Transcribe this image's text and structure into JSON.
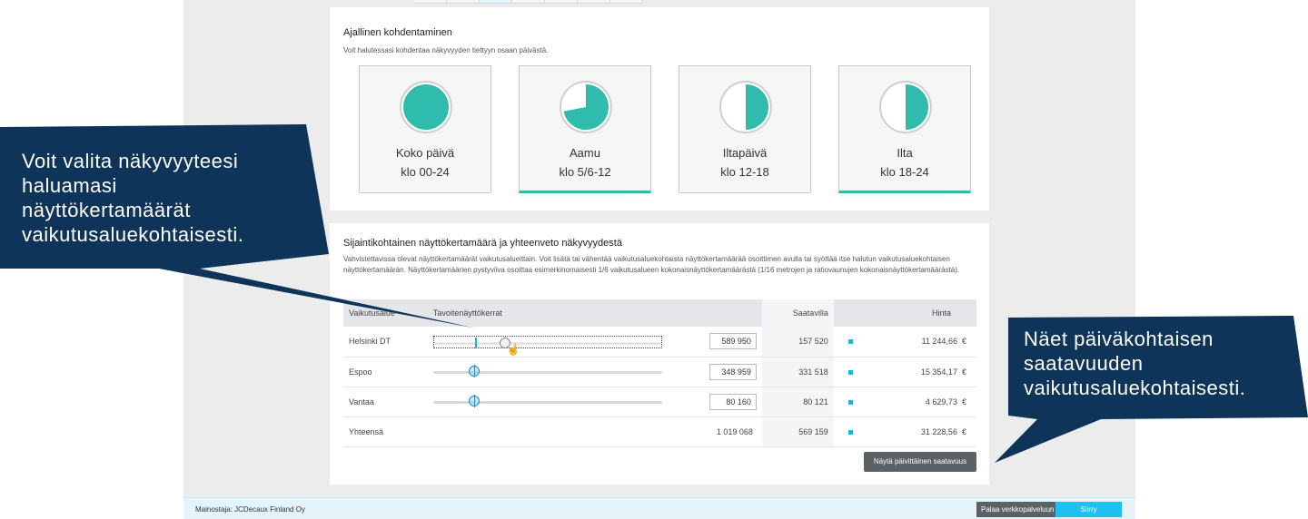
{
  "time_targeting": {
    "title": "Ajallinen kohdentaminen",
    "subtitle": "Voit halutessasi kohdentaa näkyvyyden tiettyyn osaan päivästä.",
    "options": [
      {
        "title": "Koko päivä",
        "time": "klo 00-24",
        "fill": 1.0,
        "selected": false
      },
      {
        "title": "Aamu",
        "time": "klo 5/6-12",
        "fill": 0.72,
        "selected": true
      },
      {
        "title": "Iltapäivä",
        "time": "klo 12-18",
        "fill": 0.5,
        "selected": false
      },
      {
        "title": "Ilta",
        "time": "klo 18-24",
        "fill": 0.5,
        "selected": true
      }
    ],
    "accent_color": "#2fbcac"
  },
  "location_summary": {
    "title": "Sijaintikohtainen näyttökertamäärä ja yhteenveto näkyvyydestä",
    "description": "Vahvistettavissa olevat näyttökertamäärät vaikutusalueittain. Voit lisätä tai vähentää vaikutusaluekohtaista näyttökertamäärää osoittimen avulla tai syöttää itse halutun vaikutusaluekohtaisen näyttökertamäärän. Näyttökertamäärien pystyviiva osoittaa esimerkinomaisesti 1/6 vaikutusalueen kokonaisnäyttökertamäärästä (1/16 metrojen ja ratiovaunujen kokonaisnäyttökertamäärästä).",
    "columns": {
      "area": "Vaikutusalue",
      "target": "Tavoitenäyttökerrat",
      "available": "Saatavilla",
      "price": "Hinta"
    },
    "rows": [
      {
        "area": "Helsinki DT",
        "target": "589 950",
        "available": "157 520",
        "price": "11 244,66",
        "currency": "€",
        "level": 0.31
      },
      {
        "area": "Espoo",
        "target": "348 959",
        "available": "331 518",
        "price": "15 354,17",
        "currency": "€",
        "level": 0.18
      },
      {
        "area": "Vantaa",
        "target": "80 160",
        "available": "80 121",
        "price": "4 629,73",
        "currency": "€",
        "level": 0.18
      }
    ],
    "total": {
      "label": "Yhteensä",
      "target": "1 019 068",
      "available": "569 159",
      "price": "31 228,56",
      "currency": "€"
    },
    "daily_button": "Näytä päivittäinen saatavuus",
    "availability_color": "#1bb5d4"
  },
  "footer": {
    "advertiser": "Mainostaja: JCDecaux Finland Oy",
    "back_button": "Palaa verkkopalveluun",
    "next_button": "Siirry yhteenvetoon"
  },
  "callouts": {
    "left": [
      "Voit valita näkyvyyteesi",
      "haluamasi",
      "näyttökertamäärät",
      "vaikutusaluekohtaisesti."
    ],
    "right": [
      "Näet päiväkohtaisen",
      "saatavuuden",
      "vaikutusaluekohtaisesti."
    ],
    "color": "#0e3459"
  }
}
